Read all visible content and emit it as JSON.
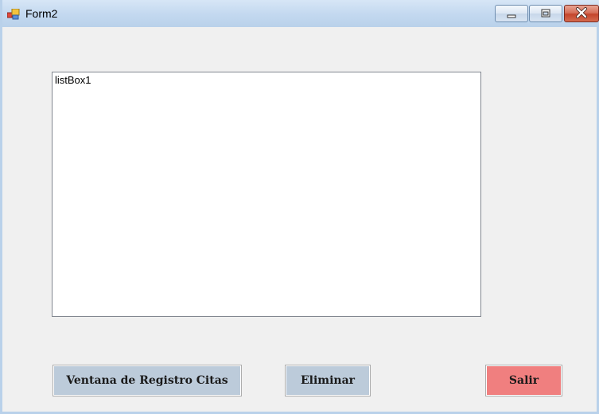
{
  "window": {
    "title": "Form2",
    "icon": "form-app-icon",
    "controls": {
      "minimize_icon": "minimize-icon",
      "maximize_icon": "maximize-icon",
      "close_icon": "close-icon"
    }
  },
  "listbox": {
    "items": [
      "listBox1"
    ]
  },
  "buttons": {
    "registro_label": "Ventana de Registro Citas",
    "eliminar_label": "Eliminar",
    "salir_label": "Salir"
  },
  "colors": {
    "button_default": "#bccbda",
    "button_exit": "#f07f7f",
    "form_background": "#f0f0f0"
  }
}
